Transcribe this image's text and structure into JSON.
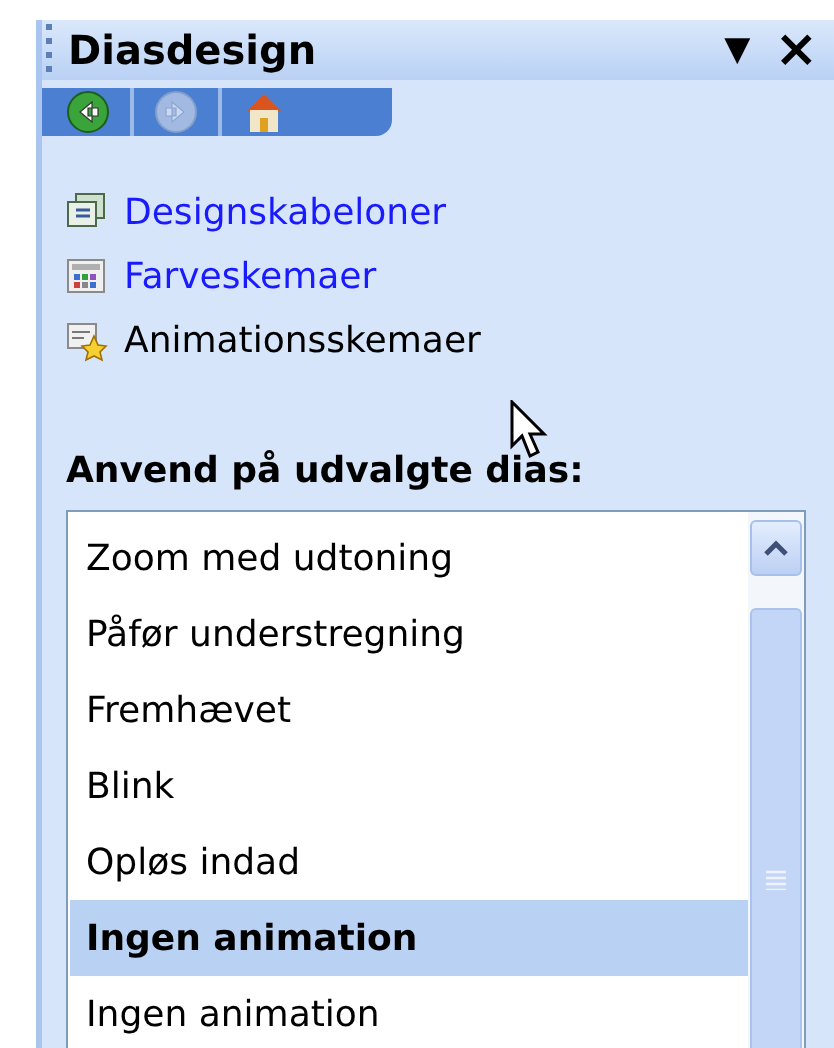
{
  "panel": {
    "title": "Diasdesign",
    "menu_glyph": "▼",
    "close_glyph": "×"
  },
  "nav_buttons": [
    {
      "kind": "back",
      "disabled": false
    },
    {
      "kind": "forward",
      "disabled": true
    },
    {
      "kind": "home",
      "disabled": false
    }
  ],
  "links": [
    {
      "kind": "templates",
      "label": "Designskabeloner",
      "hovered": false
    },
    {
      "kind": "colors",
      "label": "Farveskemaer",
      "hovered": false
    },
    {
      "kind": "animations",
      "label": "Animationsskemaer",
      "hovered": true
    }
  ],
  "list_heading": "Anvend på udvalgte dias:",
  "list_items": [
    {
      "label": "Zoom med udtoning",
      "selected": false
    },
    {
      "label": "Påfør understregning",
      "selected": false
    },
    {
      "label": "Fremhævet",
      "selected": false
    },
    {
      "label": "Blink",
      "selected": false
    },
    {
      "label": "Opløs indad",
      "selected": false
    },
    {
      "label": "Ingen animation",
      "selected": true
    },
    {
      "label": "Ingen animation",
      "selected": false
    }
  ]
}
